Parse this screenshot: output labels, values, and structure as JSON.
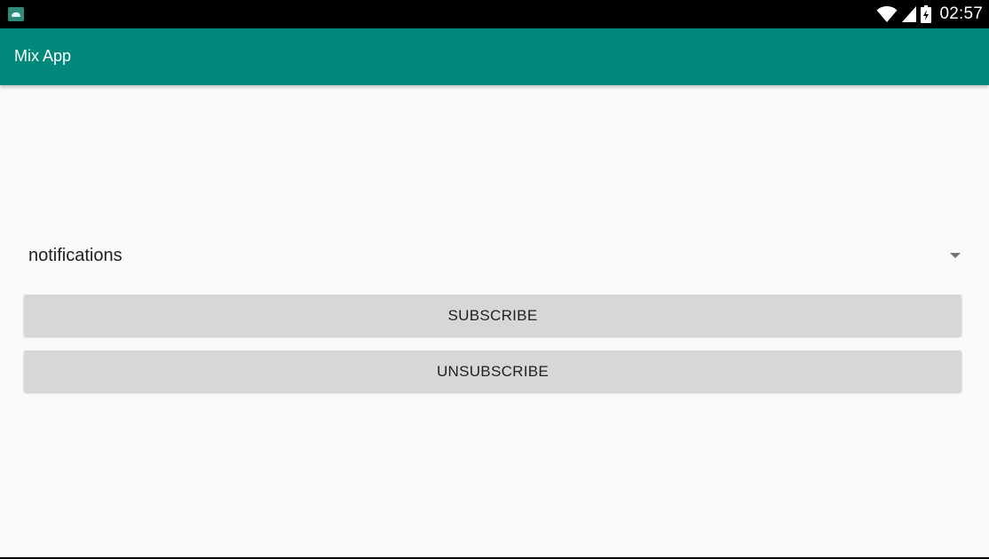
{
  "status_bar": {
    "time": "02:57",
    "icons": [
      "android-notification-icon",
      "wifi-icon",
      "cellular-signal-icon",
      "battery-icon"
    ]
  },
  "app_bar": {
    "title": "Mix App",
    "color": "#00897b"
  },
  "main": {
    "spinner": {
      "selected_value": "notifications"
    },
    "buttons": {
      "subscribe_label": "SUBSCRIBE",
      "unsubscribe_label": "UNSUBSCRIBE"
    }
  }
}
